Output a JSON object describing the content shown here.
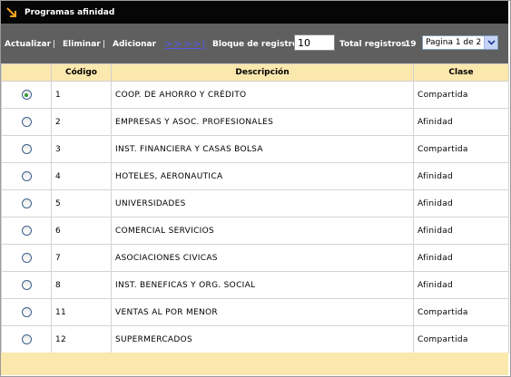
{
  "window": {
    "title": "Programas afinidad",
    "icon": "arrow-down-right-icon"
  },
  "toolbar": {
    "actualizar": "Actualizar",
    "eliminar": "Eliminar",
    "adicionar": "Adicionar",
    "sep": "|",
    "next": ">>",
    "last": ">>|",
    "bloque_label": "Bloque de registros:",
    "bloque_value": "10",
    "total_label": "Total registros:",
    "total_value": "19",
    "pagina": "Pagina 1 de 2"
  },
  "table": {
    "headers": [
      "",
      "Código",
      "Descripción",
      "Clase"
    ],
    "rows": [
      {
        "selected": true,
        "codigo": "1",
        "descripcion": "COOP. DE AHORRO Y CRÉDITO",
        "clase": "Compartida"
      },
      {
        "selected": false,
        "codigo": "2",
        "descripcion": "EMPRESAS Y ASOC. PROFESIONALES",
        "clase": "Afinidad"
      },
      {
        "selected": false,
        "codigo": "3",
        "descripcion": "INST. FINANCIERA Y CASAS BOLSA",
        "clase": "Compartida"
      },
      {
        "selected": false,
        "codigo": "4",
        "descripcion": "HOTELES, AERONAUTICA",
        "clase": "Afinidad"
      },
      {
        "selected": false,
        "codigo": "5",
        "descripcion": "UNIVERSIDADES",
        "clase": "Afinidad"
      },
      {
        "selected": false,
        "codigo": "6",
        "descripcion": "COMERCIAL SERVICIOS",
        "clase": "Afinidad"
      },
      {
        "selected": false,
        "codigo": "7",
        "descripcion": "ASOCIACIONES CIVICAS",
        "clase": "Afinidad"
      },
      {
        "selected": false,
        "codigo": "8",
        "descripcion": "INST. BENEFICAS Y ORG. SOCIAL",
        "clase": "Afinidad"
      },
      {
        "selected": false,
        "codigo": "11",
        "descripcion": "VENTAS AL POR MENOR",
        "clase": "Compartida"
      },
      {
        "selected": false,
        "codigo": "12",
        "descripcion": "SUPERMERCADOS",
        "clase": "Compartida"
      }
    ]
  },
  "colors": {
    "titlebar": "#060606",
    "toolbar": "#5f5f5f",
    "header": "#fbe8ad",
    "accent_icon": "#f0a020",
    "link": "#5555ee",
    "radio_selected": "#2f9a2f"
  }
}
